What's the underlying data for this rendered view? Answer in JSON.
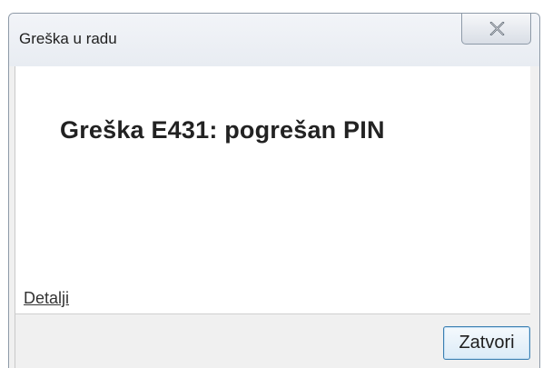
{
  "dialog": {
    "title": "Greška u radu",
    "close_icon": "close-x-icon",
    "message": "Greška E431: pogrešan PIN",
    "details_link": "Detalji",
    "close_button_label": "Zatvori"
  },
  "colors": {
    "dialog_background": "#f0f0f0",
    "content_background": "#ffffff",
    "window_border": "#8e9aa8",
    "button_border": "#3c7fb1"
  }
}
